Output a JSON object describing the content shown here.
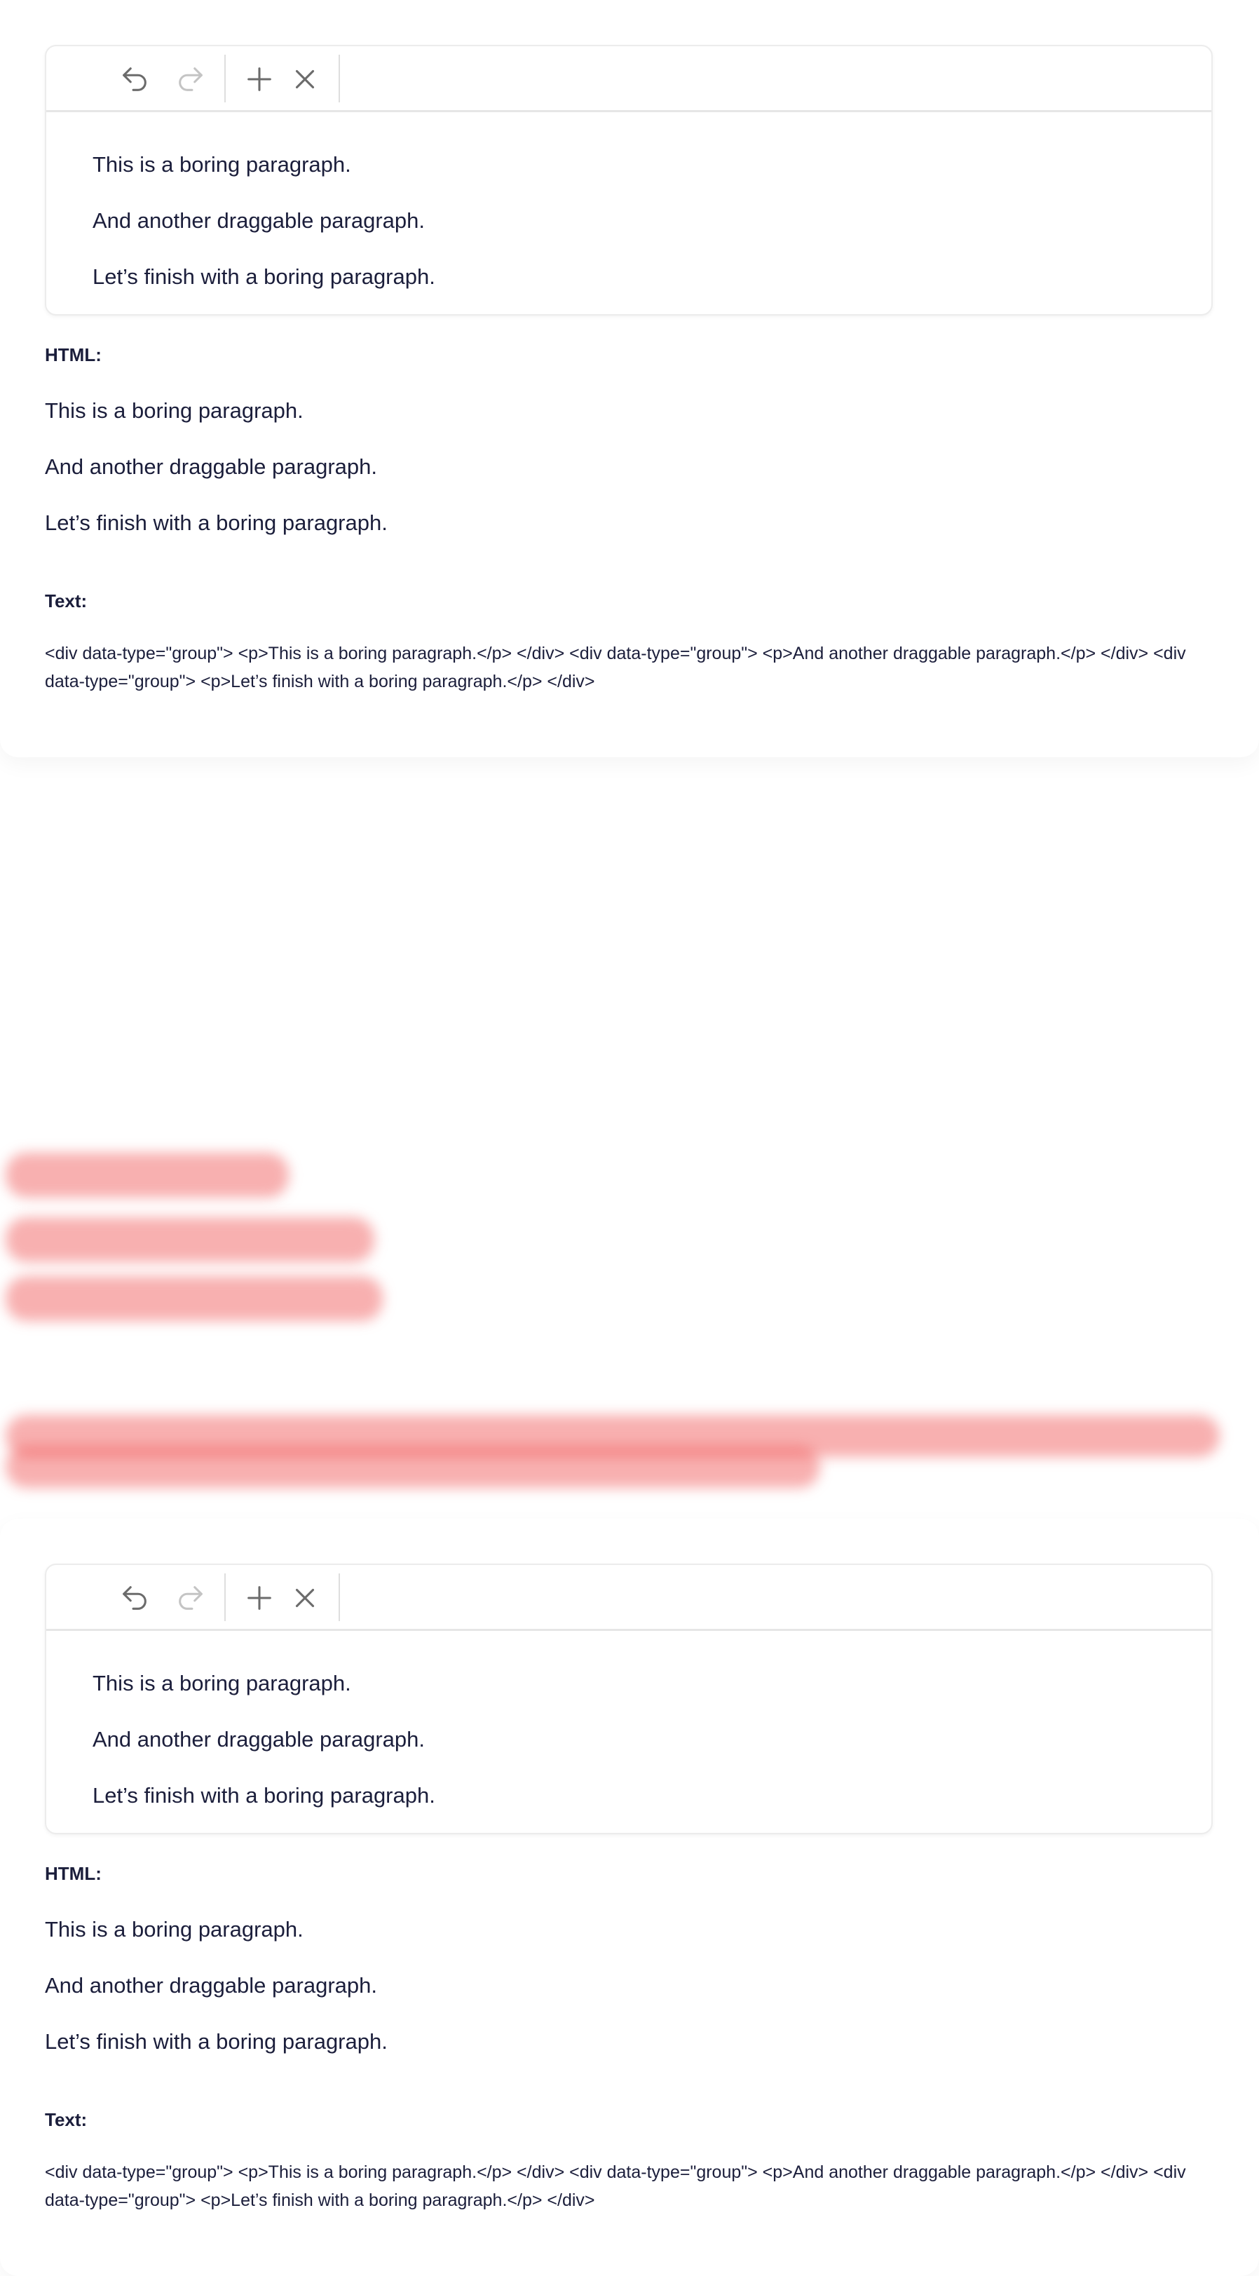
{
  "editor": {
    "toolbar": {
      "undo_icon": "undo-icon",
      "redo_icon": "redo-icon",
      "add_icon": "plus-icon",
      "remove_icon": "close-icon"
    },
    "paragraphs": [
      "This is a boring paragraph.",
      "And another draggable paragraph.",
      "Let’s finish with a boring paragraph."
    ]
  },
  "html_label": "HTML:",
  "html_paragraphs": [
    "This is a boring paragraph.",
    "And another draggable paragraph.",
    "Let’s finish with a boring paragraph."
  ],
  "text_label": "Text:",
  "text_output": "<div data-type=\"group\"> <p>This is a boring paragraph.</p> </div> <div data-type=\"group\"> <p>And another draggable paragraph.</p> </div> <div data-type=\"group\"> <p>Let’s finish with a boring paragraph.</p> </div>",
  "colors": {
    "text": "#1b1e3b",
    "icon": "#6b6b6b",
    "icon_disabled": "#c4c4c4",
    "blur": "#f05050"
  }
}
